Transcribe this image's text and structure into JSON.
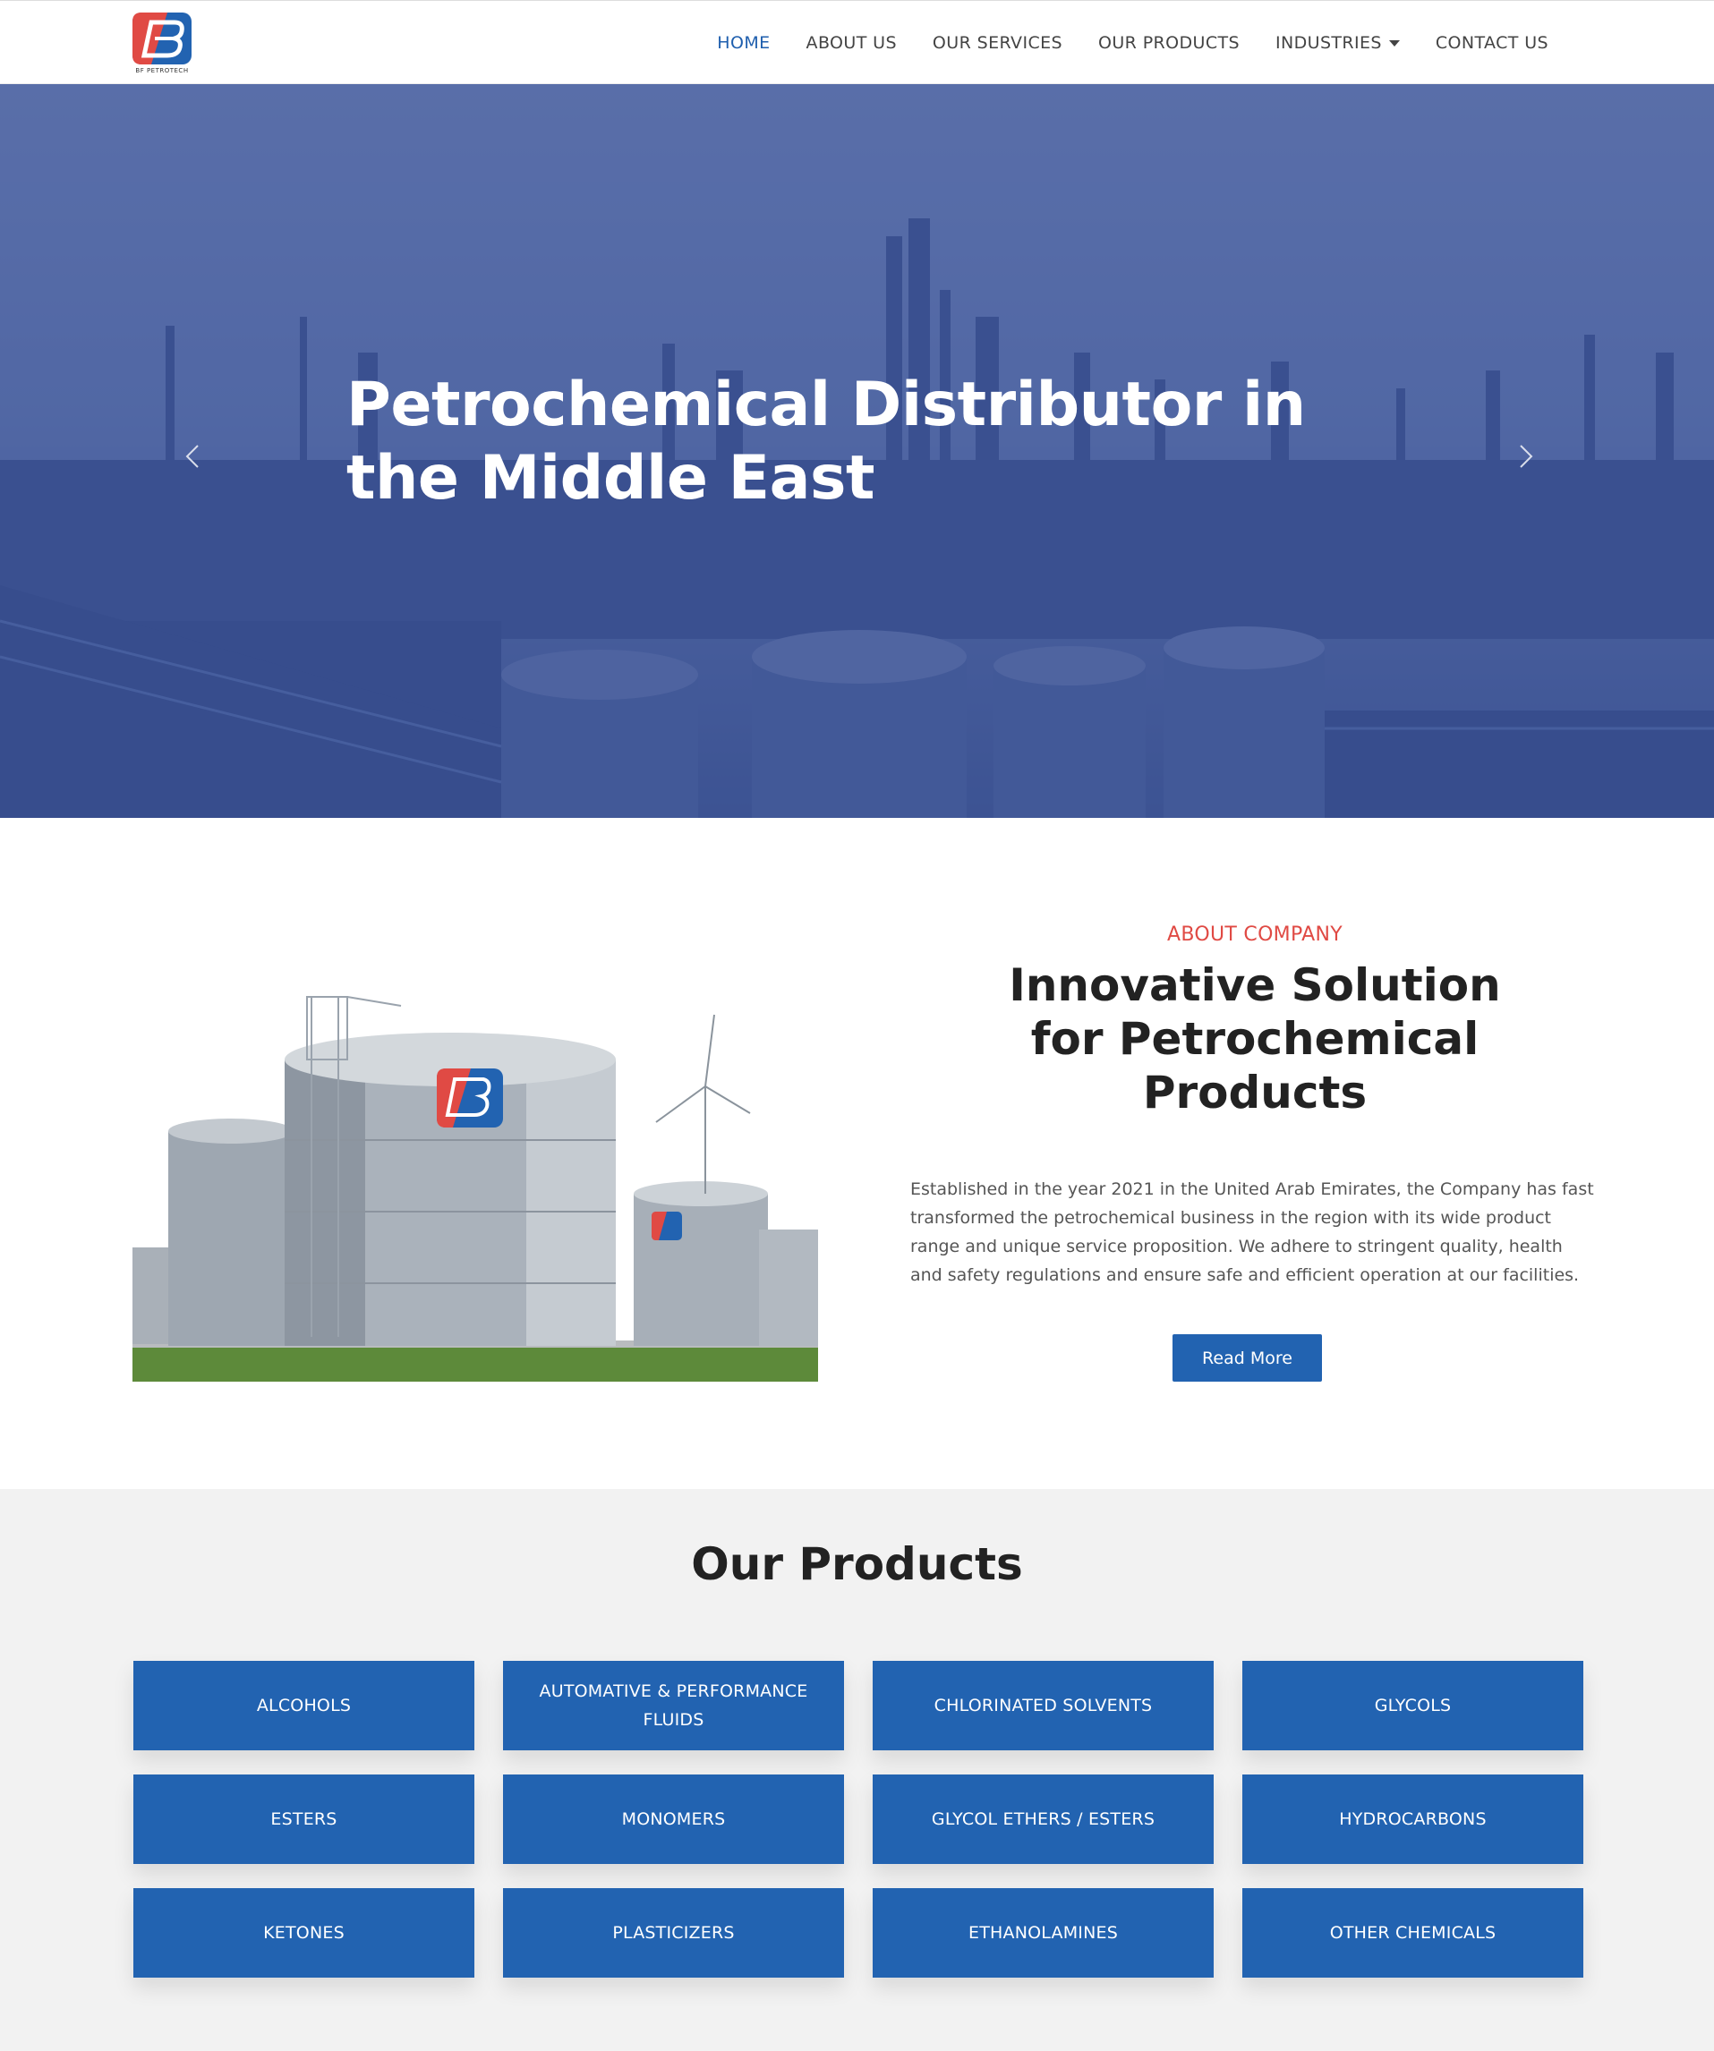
{
  "brand": {
    "logo_text": "BF PETROTECH",
    "primary_color": "#2263b1",
    "accent_color": "#e04a44"
  },
  "nav": {
    "items": [
      {
        "label": "HOME",
        "active": true
      },
      {
        "label": "ABOUT US",
        "active": false
      },
      {
        "label": "OUR SERVICES",
        "active": false
      },
      {
        "label": "OUR PRODUCTS",
        "active": false
      },
      {
        "label": "INDUSTRIES",
        "active": false,
        "dropdown": true
      },
      {
        "label": "CONTACT US",
        "active": false
      }
    ]
  },
  "hero": {
    "title": "Petrochemical Distributor in the Middle East",
    "prev_icon": "chevron-left-icon",
    "next_icon": "chevron-right-icon"
  },
  "about": {
    "eyebrow": "ABOUT COMPANY",
    "heading": "Innovative Solution for Petrochemical Products",
    "text": "Established in the year 2021 in the United Arab Emirates, the Company has fast transformed the petrochemical business in the region with its wide product range and unique service proposition. We adhere to stringent quality, health and safety regulations and ensure safe and efficient operation at our facilities.",
    "button_label": "Read More"
  },
  "products": {
    "title": "Our Products",
    "items": [
      "ALCOHOLS",
      "AUTOMATIVE & PERFORMANCE FLUIDS",
      "CHLORINATED SOLVENTS",
      "GLYCOLS",
      "ESTERS",
      "MONOMERS",
      "GLYCOL ETHERS / ESTERS",
      "HYDROCARBONS",
      "KETONES",
      "PLASTICIZERS",
      "ETHANOLAMINES",
      "OTHER CHEMICALS"
    ]
  }
}
